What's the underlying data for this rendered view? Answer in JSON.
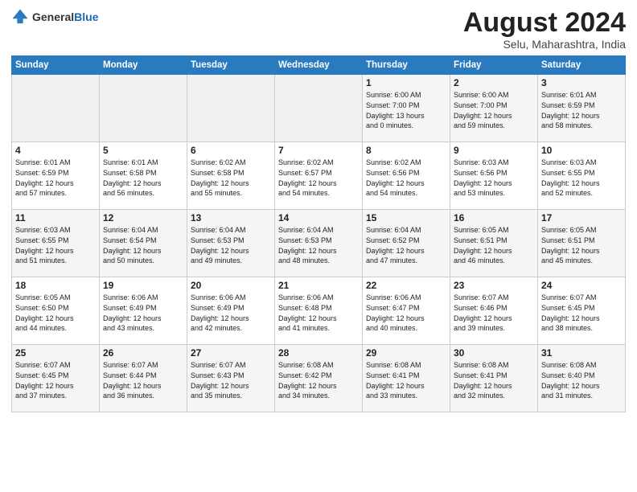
{
  "header": {
    "logo_line1": "General",
    "logo_line2": "Blue",
    "month": "August 2024",
    "location": "Selu, Maharashtra, India"
  },
  "days_of_week": [
    "Sunday",
    "Monday",
    "Tuesday",
    "Wednesday",
    "Thursday",
    "Friday",
    "Saturday"
  ],
  "weeks": [
    [
      {
        "num": "",
        "info": ""
      },
      {
        "num": "",
        "info": ""
      },
      {
        "num": "",
        "info": ""
      },
      {
        "num": "",
        "info": ""
      },
      {
        "num": "1",
        "info": "Sunrise: 6:00 AM\nSunset: 7:00 PM\nDaylight: 13 hours\nand 0 minutes."
      },
      {
        "num": "2",
        "info": "Sunrise: 6:00 AM\nSunset: 7:00 PM\nDaylight: 12 hours\nand 59 minutes."
      },
      {
        "num": "3",
        "info": "Sunrise: 6:01 AM\nSunset: 6:59 PM\nDaylight: 12 hours\nand 58 minutes."
      }
    ],
    [
      {
        "num": "4",
        "info": "Sunrise: 6:01 AM\nSunset: 6:59 PM\nDaylight: 12 hours\nand 57 minutes."
      },
      {
        "num": "5",
        "info": "Sunrise: 6:01 AM\nSunset: 6:58 PM\nDaylight: 12 hours\nand 56 minutes."
      },
      {
        "num": "6",
        "info": "Sunrise: 6:02 AM\nSunset: 6:58 PM\nDaylight: 12 hours\nand 55 minutes."
      },
      {
        "num": "7",
        "info": "Sunrise: 6:02 AM\nSunset: 6:57 PM\nDaylight: 12 hours\nand 54 minutes."
      },
      {
        "num": "8",
        "info": "Sunrise: 6:02 AM\nSunset: 6:56 PM\nDaylight: 12 hours\nand 54 minutes."
      },
      {
        "num": "9",
        "info": "Sunrise: 6:03 AM\nSunset: 6:56 PM\nDaylight: 12 hours\nand 53 minutes."
      },
      {
        "num": "10",
        "info": "Sunrise: 6:03 AM\nSunset: 6:55 PM\nDaylight: 12 hours\nand 52 minutes."
      }
    ],
    [
      {
        "num": "11",
        "info": "Sunrise: 6:03 AM\nSunset: 6:55 PM\nDaylight: 12 hours\nand 51 minutes."
      },
      {
        "num": "12",
        "info": "Sunrise: 6:04 AM\nSunset: 6:54 PM\nDaylight: 12 hours\nand 50 minutes."
      },
      {
        "num": "13",
        "info": "Sunrise: 6:04 AM\nSunset: 6:53 PM\nDaylight: 12 hours\nand 49 minutes."
      },
      {
        "num": "14",
        "info": "Sunrise: 6:04 AM\nSunset: 6:53 PM\nDaylight: 12 hours\nand 48 minutes."
      },
      {
        "num": "15",
        "info": "Sunrise: 6:04 AM\nSunset: 6:52 PM\nDaylight: 12 hours\nand 47 minutes."
      },
      {
        "num": "16",
        "info": "Sunrise: 6:05 AM\nSunset: 6:51 PM\nDaylight: 12 hours\nand 46 minutes."
      },
      {
        "num": "17",
        "info": "Sunrise: 6:05 AM\nSunset: 6:51 PM\nDaylight: 12 hours\nand 45 minutes."
      }
    ],
    [
      {
        "num": "18",
        "info": "Sunrise: 6:05 AM\nSunset: 6:50 PM\nDaylight: 12 hours\nand 44 minutes."
      },
      {
        "num": "19",
        "info": "Sunrise: 6:06 AM\nSunset: 6:49 PM\nDaylight: 12 hours\nand 43 minutes."
      },
      {
        "num": "20",
        "info": "Sunrise: 6:06 AM\nSunset: 6:49 PM\nDaylight: 12 hours\nand 42 minutes."
      },
      {
        "num": "21",
        "info": "Sunrise: 6:06 AM\nSunset: 6:48 PM\nDaylight: 12 hours\nand 41 minutes."
      },
      {
        "num": "22",
        "info": "Sunrise: 6:06 AM\nSunset: 6:47 PM\nDaylight: 12 hours\nand 40 minutes."
      },
      {
        "num": "23",
        "info": "Sunrise: 6:07 AM\nSunset: 6:46 PM\nDaylight: 12 hours\nand 39 minutes."
      },
      {
        "num": "24",
        "info": "Sunrise: 6:07 AM\nSunset: 6:45 PM\nDaylight: 12 hours\nand 38 minutes."
      }
    ],
    [
      {
        "num": "25",
        "info": "Sunrise: 6:07 AM\nSunset: 6:45 PM\nDaylight: 12 hours\nand 37 minutes."
      },
      {
        "num": "26",
        "info": "Sunrise: 6:07 AM\nSunset: 6:44 PM\nDaylight: 12 hours\nand 36 minutes."
      },
      {
        "num": "27",
        "info": "Sunrise: 6:07 AM\nSunset: 6:43 PM\nDaylight: 12 hours\nand 35 minutes."
      },
      {
        "num": "28",
        "info": "Sunrise: 6:08 AM\nSunset: 6:42 PM\nDaylight: 12 hours\nand 34 minutes."
      },
      {
        "num": "29",
        "info": "Sunrise: 6:08 AM\nSunset: 6:41 PM\nDaylight: 12 hours\nand 33 minutes."
      },
      {
        "num": "30",
        "info": "Sunrise: 6:08 AM\nSunset: 6:41 PM\nDaylight: 12 hours\nand 32 minutes."
      },
      {
        "num": "31",
        "info": "Sunrise: 6:08 AM\nSunset: 6:40 PM\nDaylight: 12 hours\nand 31 minutes."
      }
    ]
  ]
}
